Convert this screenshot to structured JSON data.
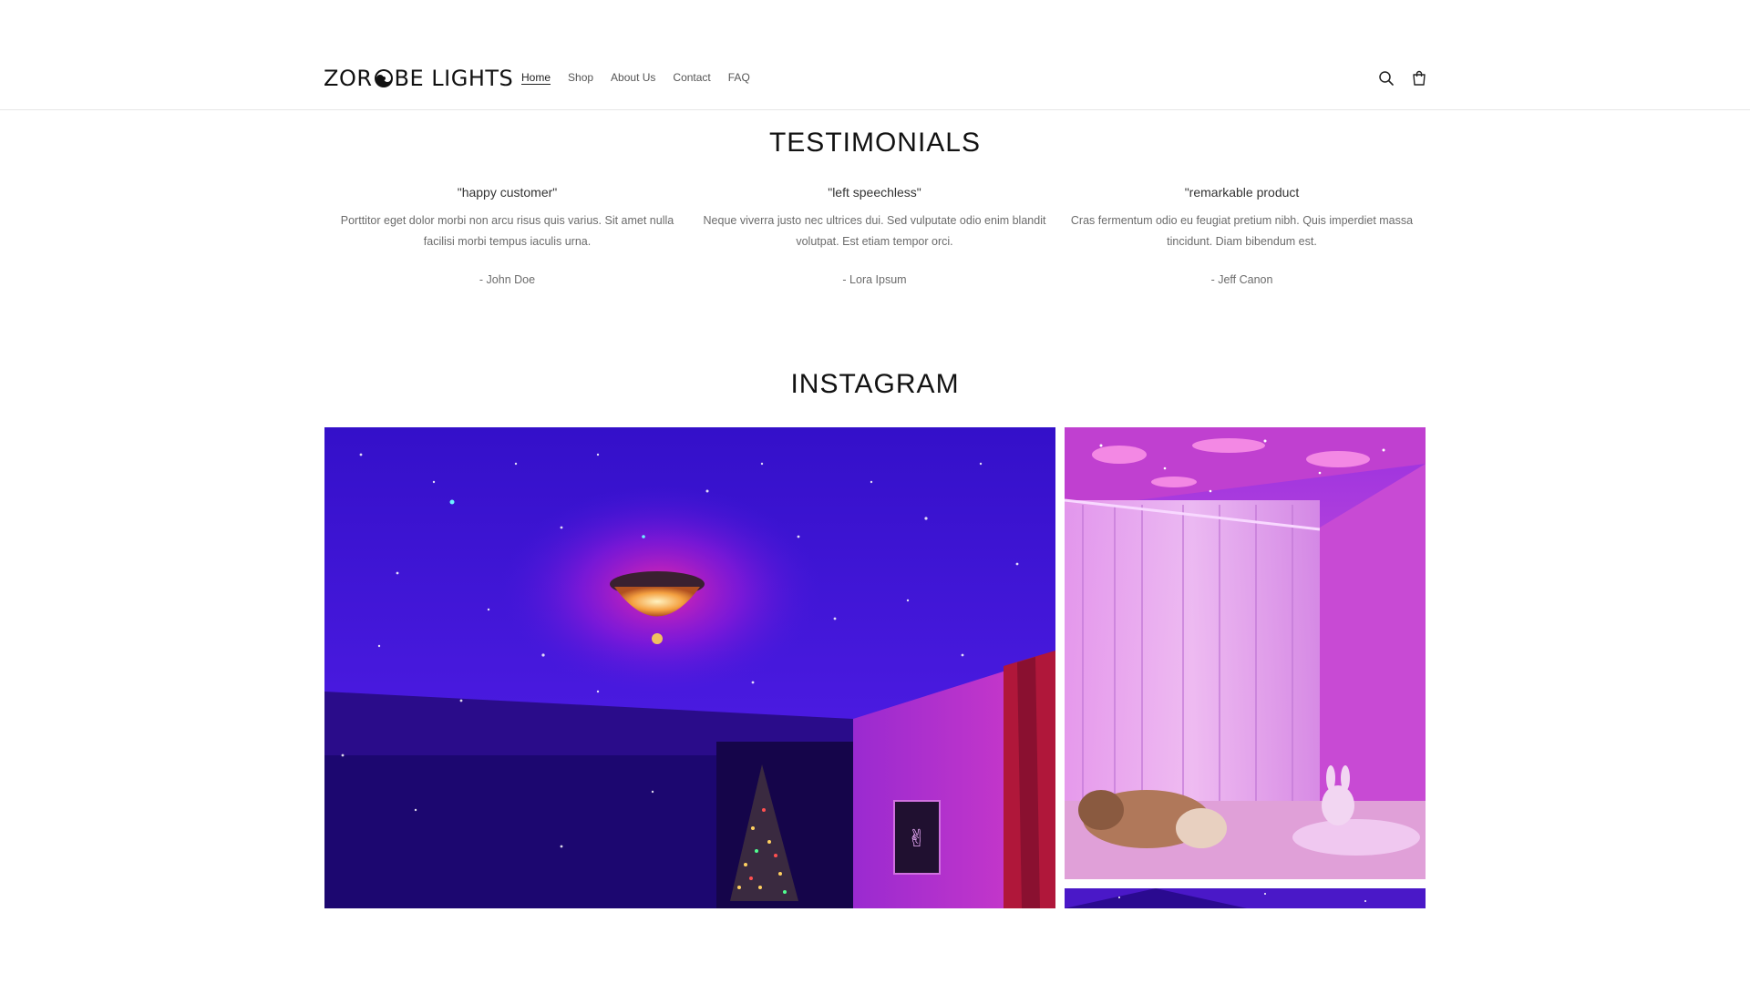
{
  "header": {
    "logo_text_1": "ZOR",
    "logo_text_2": "BE LIGHTS",
    "nav": [
      {
        "label": "Home",
        "active": true
      },
      {
        "label": "Shop",
        "active": false
      },
      {
        "label": "About Us",
        "active": false
      },
      {
        "label": "Contact",
        "active": false
      },
      {
        "label": "FAQ",
        "active": false
      }
    ],
    "icons": [
      "search-icon",
      "cart-icon"
    ]
  },
  "testimonials": {
    "title": "TESTIMONIALS",
    "items": [
      {
        "heading": "\"happy customer\"",
        "body": "Porttitor eget dolor morbi non arcu risus quis varius. Sit amet nulla facilisi morbi tempus iaculis urna.",
        "author": "- John Doe"
      },
      {
        "heading": "\"left speechless\"",
        "body": "Neque viverra justo nec ultrices dui. Sed vulputate odio enim blandit volutpat. Est etiam tempor orci.",
        "author": "- Lora Ipsum"
      },
      {
        "heading": "\"remarkable product",
        "body": "Cras fermentum odio eu feugiat pretium nibh. Quis imperdiet massa tincidunt. Diam bibendum est.",
        "author": "- Jeff Canon"
      }
    ]
  },
  "instagram": {
    "title": "INSTAGRAM"
  },
  "colors": {
    "accent_purple": "#3a1fd6",
    "accent_pink": "#d64fd6"
  }
}
